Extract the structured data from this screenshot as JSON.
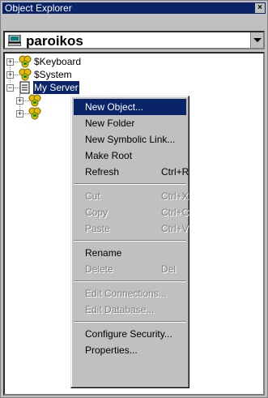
{
  "window": {
    "title": "Object Explorer",
    "close_glyph": "×"
  },
  "server_selector": {
    "name": "paroikos",
    "icon": "computer-icon"
  },
  "tree": {
    "items": [
      {
        "label": "$Keyboard",
        "expander": "+",
        "icon": "object-cluster-icon"
      },
      {
        "label": "$System",
        "expander": "+",
        "icon": "object-cluster-icon"
      },
      {
        "label": "My Server",
        "expander": "−",
        "icon": "document-icon"
      },
      {
        "expander": "+",
        "icon": "object-cluster-icon"
      },
      {
        "expander": "+",
        "icon": "object-cluster-icon"
      }
    ]
  },
  "context_menu": {
    "items": [
      {
        "label": "New Object...",
        "shortcut": "",
        "enabled": true,
        "highlighted": true
      },
      {
        "label": "New Folder",
        "shortcut": "",
        "enabled": true
      },
      {
        "label": "New Symbolic Link...",
        "shortcut": "",
        "enabled": true
      },
      {
        "label": "Make Root",
        "shortcut": "",
        "enabled": true
      },
      {
        "label": "Refresh",
        "shortcut": "Ctrl+R",
        "enabled": true
      },
      {
        "label": "Cut",
        "shortcut": "Ctrl+X",
        "enabled": false
      },
      {
        "label": "Copy",
        "shortcut": "Ctrl+C",
        "enabled": false
      },
      {
        "label": "Paste",
        "shortcut": "Ctrl+V",
        "enabled": false
      },
      {
        "label": "Rename",
        "shortcut": "",
        "enabled": true
      },
      {
        "label": "Delete",
        "shortcut": "Del",
        "enabled": false
      },
      {
        "label": "Edit Connections...",
        "shortcut": "",
        "enabled": false
      },
      {
        "label": "Edit Database...",
        "shortcut": "",
        "enabled": false
      },
      {
        "label": "Configure Security...",
        "shortcut": "",
        "enabled": true
      },
      {
        "label": "Properties...",
        "shortcut": "",
        "enabled": true
      }
    ]
  },
  "colors": {
    "highlight": "#0a246a",
    "face": "#c0c0c0",
    "disabled": "#808080"
  }
}
